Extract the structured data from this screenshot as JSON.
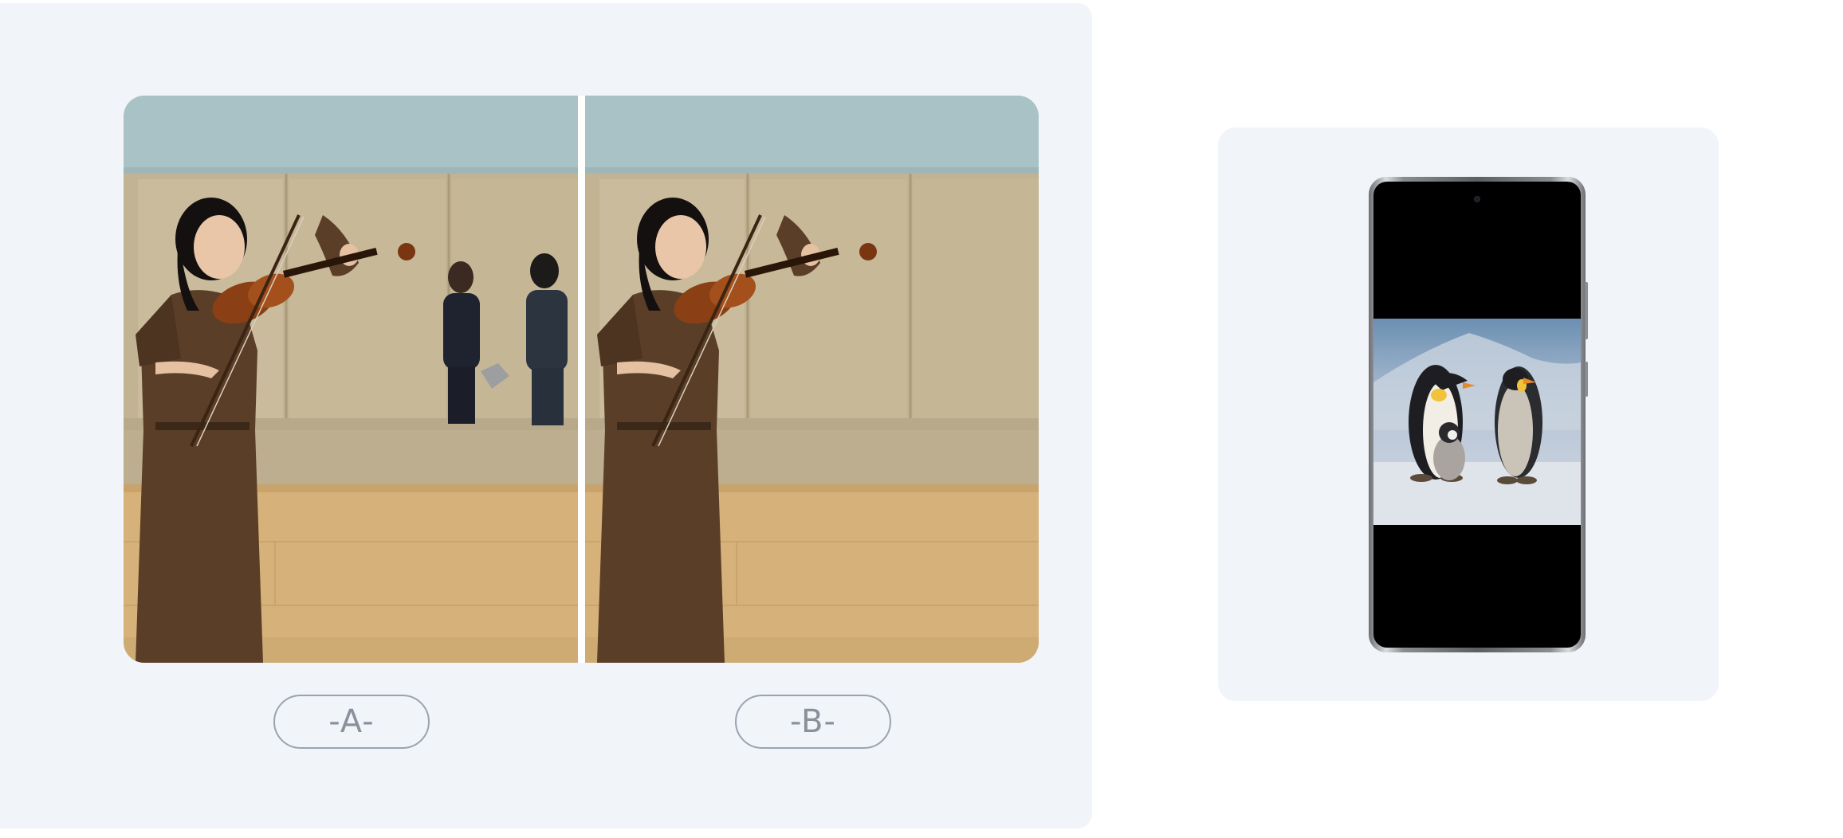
{
  "comparison": {
    "option_a_label": "-A-",
    "option_b_label": "-B-",
    "photo_a_icon": "violinist-photo-with-passersby",
    "photo_b_icon": "violinist-photo-cleaned"
  },
  "phone_preview": {
    "screen_icon": "penguin-family-photo"
  },
  "colors": {
    "panel_bg": "#f1f4f9",
    "label_border": "#9ba3ad",
    "label_text": "#8a919b"
  }
}
